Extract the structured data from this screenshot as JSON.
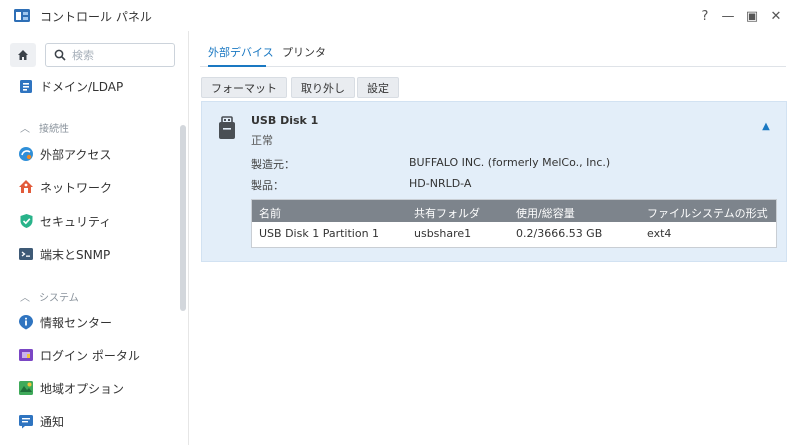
{
  "window": {
    "title": "コントロール パネル",
    "controls": {
      "help": "?",
      "minimize": "—",
      "maximize": "▣",
      "close": "✕"
    }
  },
  "sidebar": {
    "search_placeholder": "検索",
    "items_top": [
      {
        "label": "ドメイン/LDAP",
        "icon": "domain-ldap-icon"
      }
    ],
    "sections": [
      {
        "title": "接続性",
        "items": [
          {
            "label": "外部アクセス",
            "icon": "external-access-icon"
          },
          {
            "label": "ネットワーク",
            "icon": "network-icon"
          },
          {
            "label": "セキュリティ",
            "icon": "security-shield-icon"
          },
          {
            "label": "端末とSNMP",
            "icon": "terminal-icon"
          }
        ]
      },
      {
        "title": "システム",
        "items": [
          {
            "label": "情報センター",
            "icon": "info-center-icon"
          },
          {
            "label": "ログイン ポータル",
            "icon": "login-portal-icon"
          },
          {
            "label": "地域オプション",
            "icon": "regional-options-icon"
          },
          {
            "label": "通知",
            "icon": "notification-icon"
          }
        ]
      }
    ]
  },
  "main": {
    "tabs": [
      {
        "label": "外部デバイス",
        "active": true
      },
      {
        "label": "プリンタ",
        "active": false
      }
    ],
    "toolbar": {
      "format": "フォーマット",
      "eject": "取り外し",
      "settings": "設定"
    },
    "device": {
      "name": "USB Disk 1",
      "status": "正常",
      "manufacturer_label": "製造元：",
      "manufacturer": "BUFFALO INC. (formerly MelCo., Inc.)",
      "product_label": "製品：",
      "product": "HD-NRLD-A",
      "table": {
        "headers": [
          "名前",
          "共有フォルダ",
          "使用/総容量",
          "ファイルシステムの形式"
        ],
        "rows": [
          [
            "USB Disk 1 Partition 1",
            "usbshare1",
            "0.2/3666.53 GB",
            "ext4"
          ]
        ]
      }
    }
  },
  "colors": {
    "accent": "#1a78c2",
    "panel_bg": "#e3eef9",
    "table_header": "#7d848c"
  }
}
